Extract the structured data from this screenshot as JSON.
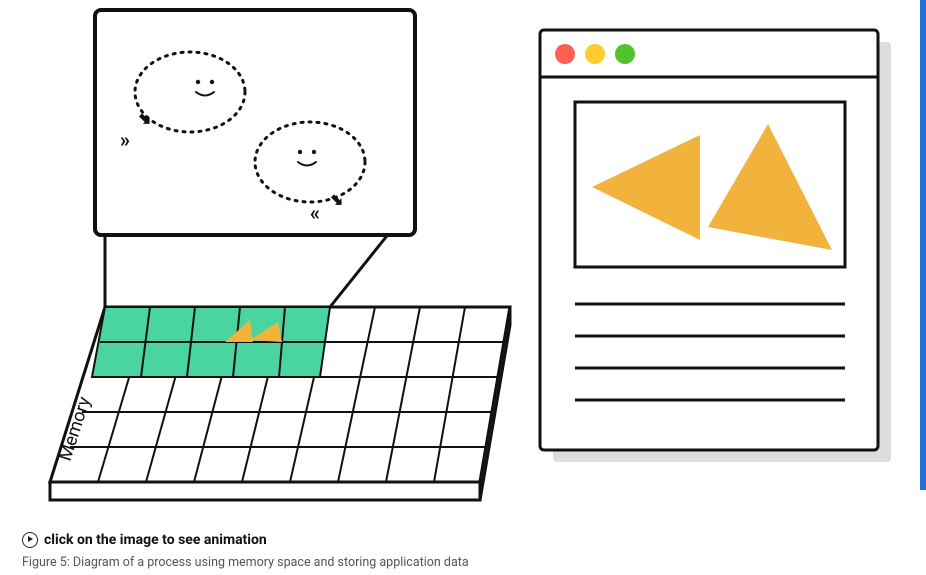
{
  "memory_label": "Memory",
  "play_caption": "click on the image to see animation",
  "figure_caption": "Figure 5: Diagram of a process using memory space and storing application data",
  "colors": {
    "triangle": "#f1b33c",
    "memory_cell": "#49d4a0",
    "dot_red": "#ff5f52",
    "dot_yellow": "#ffcb2f",
    "dot_green": "#54c22c",
    "scrollbar": "#2a6dd6"
  }
}
